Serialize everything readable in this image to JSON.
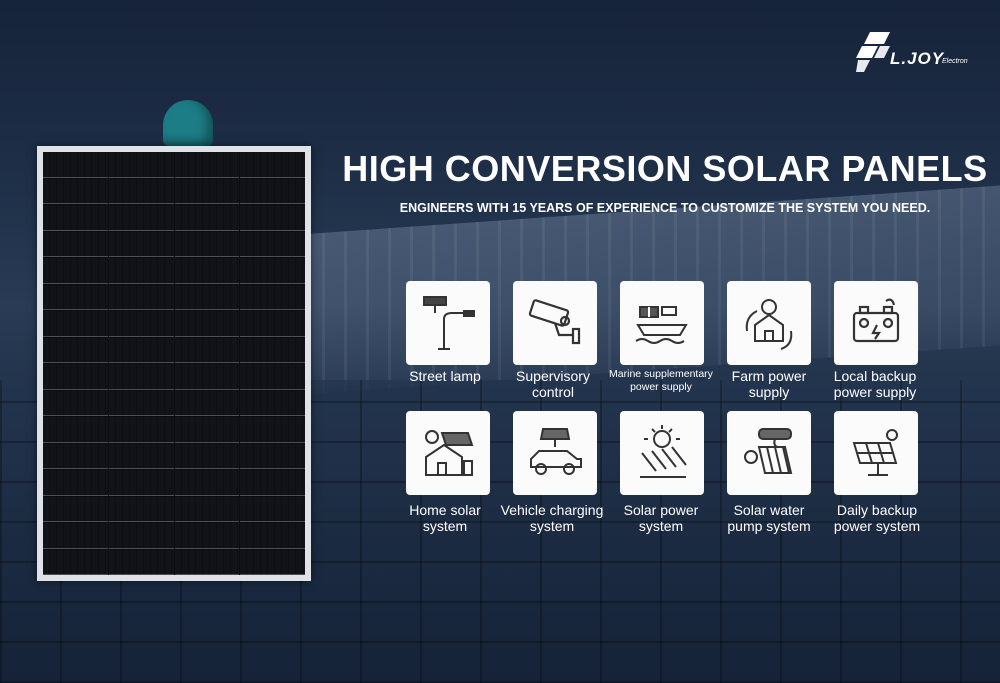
{
  "brand": {
    "name": "L.JOY",
    "sub": "Electron"
  },
  "heading": {
    "title": "HIGH CONVERSION SOLAR PANELS",
    "subtitle": "ENGINEERS WITH 15 YEARS OF EXPERIENCE TO CUSTOMIZE THE SYSTEM YOU NEED."
  },
  "applications": [
    {
      "icon": "street-lamp-icon",
      "line1": "Street lamp",
      "line2": ""
    },
    {
      "icon": "surveillance-camera-icon",
      "line1": "Supervisory",
      "line2": "control"
    },
    {
      "icon": "ship-icon",
      "line1": "Marine supplementary",
      "line2": "power supply"
    },
    {
      "icon": "farm-house-icon",
      "line1": "Farm power",
      "line2": "supply"
    },
    {
      "icon": "battery-icon",
      "line1": "Local backup",
      "line2": "power supply"
    },
    {
      "icon": "home-solar-icon",
      "line1": "Home solar",
      "line2": "system"
    },
    {
      "icon": "electric-car-icon",
      "line1": "Vehicle charging",
      "line2": "system"
    },
    {
      "icon": "solar-array-icon",
      "line1": "Solar power",
      "line2": "system"
    },
    {
      "icon": "water-heater-icon",
      "line1": "Solar water",
      "line2": "pump system"
    },
    {
      "icon": "solar-panel-stand-icon",
      "line1": "Daily backup",
      "line2": "power system"
    }
  ],
  "colors": {
    "text": "#ffffff",
    "tile": "#fbfbfb",
    "icon": "#333333"
  }
}
